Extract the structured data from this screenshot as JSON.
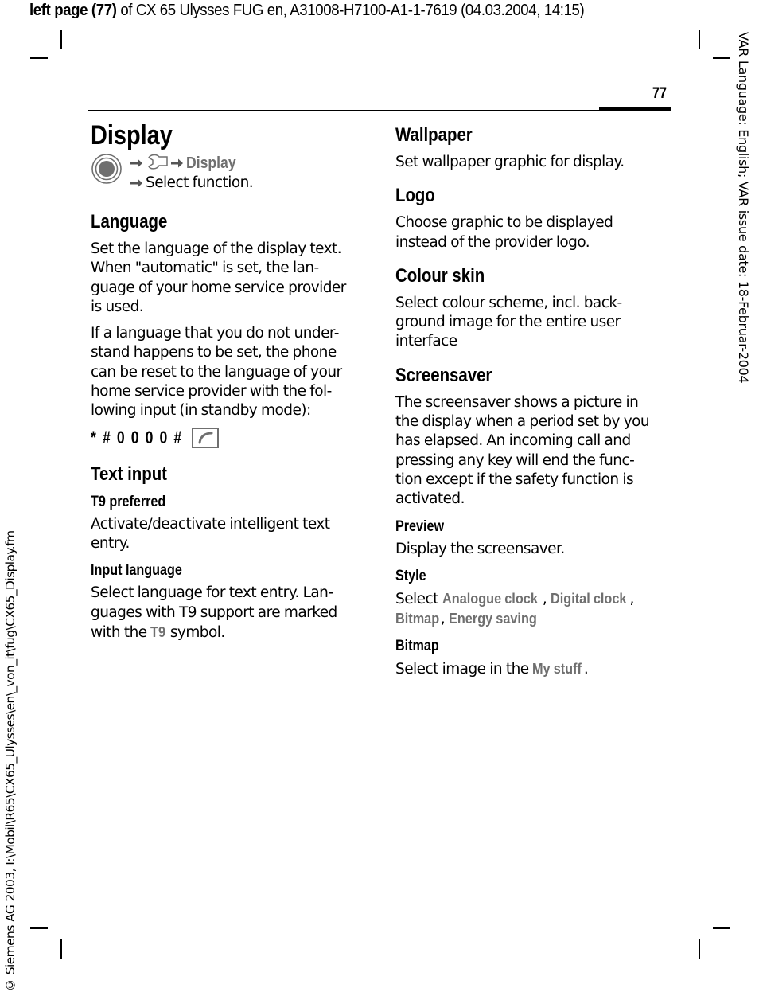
{
  "header": {
    "prefix_bold": "left page (77)",
    "rest": " of CX 65 Ulysses FUG en, A31008-H7100-A1-1-7619 (04.03.2004, 14:15)"
  },
  "page_number": "77",
  "side_right": "VAR Language: English; VAR issue date: 18-Februar-2004",
  "side_left": "© Siemens AG 2003, I:\\Mobil\\R65\\CX65_Ulysses\\en\\_von_it\\fug\\CX65_Display.fm",
  "icons": {
    "menu_key": "menu-key-icon",
    "arrow": "arrow-right-icon",
    "settings": "wrench-settings-icon",
    "call_key": "call-key-icon"
  },
  "colors": {
    "menu_text": "#6f6f6f",
    "text": "#000000"
  },
  "left": {
    "title": "Display",
    "nav_path_item": "Display",
    "nav_instruction": "Select function.",
    "language": {
      "heading": "Language",
      "para1": [
        "Set the language of the display text.",
        "When \"automatic\" is set, the lan-",
        "guage of your home service provider",
        "is used."
      ],
      "para2": [
        "If a language that you do not under-",
        "stand happens to be set, the phone",
        "can be reset to the language of your",
        "home service provider with the fol-",
        "lowing input (in standby mode):"
      ],
      "reset_code": "* # 0 0 0 0 #"
    },
    "text_input": {
      "heading": "Text input",
      "t9_heading": "T9 preferred",
      "t9_text": [
        "Activate/deactivate intelligent text",
        "entry."
      ],
      "input_lang_heading": "Input language",
      "input_lang_text": [
        "Select language for text entry. Lan-",
        "guages with T9 support are marked"
      ],
      "input_lang_last_pre": "with the ",
      "input_lang_last_menu": "T9",
      "input_lang_last_post": " symbol."
    }
  },
  "right": {
    "wallpaper": {
      "heading": "Wallpaper",
      "text": "Set wallpaper graphic for display."
    },
    "logo": {
      "heading": "Logo",
      "text": [
        "Choose graphic to be displayed",
        "instead of the provider logo."
      ]
    },
    "colour_skin": {
      "heading": "Colour skin",
      "text": [
        "Select colour scheme, incl. back-",
        "ground image for the entire user",
        "interface"
      ]
    },
    "screensaver": {
      "heading": "Screensaver",
      "text": [
        "The screensaver shows a picture in",
        "the display when a period set by you",
        "has elapsed. An incoming call and",
        "pressing any key will end the func-",
        "tion except if the safety function is",
        "activated."
      ],
      "preview_heading": "Preview",
      "preview_text": "Display the screensaver.",
      "style_heading": "Style",
      "style_pre": "Select ",
      "style_options": [
        "Analogue clock",
        "Digital clock",
        "Bitmap",
        "Energy saving"
      ],
      "bitmap_heading": "Bitmap",
      "bitmap_pre": "Select image in the ",
      "bitmap_menu": "My stuff",
      "bitmap_post": "."
    }
  }
}
